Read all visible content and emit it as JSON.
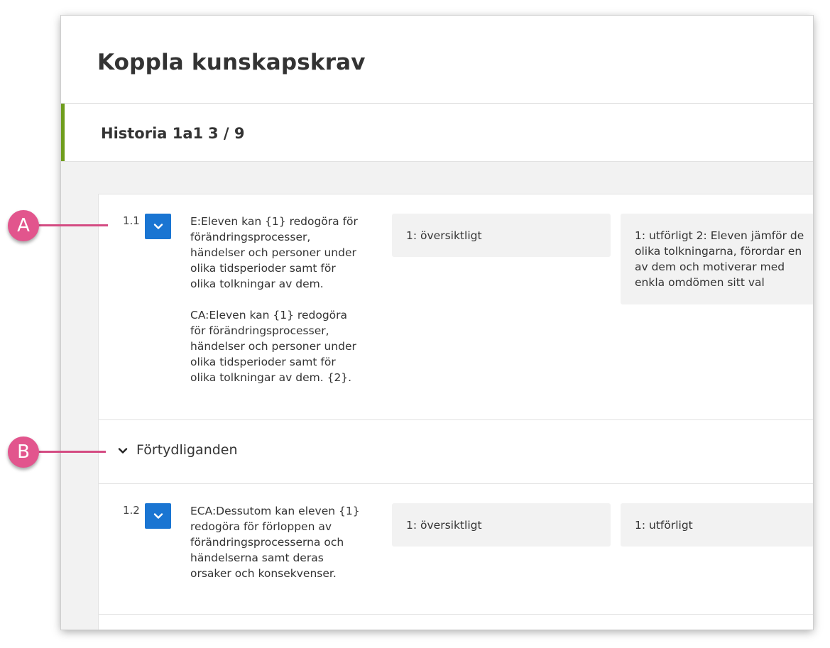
{
  "dialog": {
    "title": "Koppla kunskapskrav"
  },
  "subject": {
    "name": "Historia 1a1",
    "progress": "3 / 9",
    "accent_color": "#6f9d1c"
  },
  "criteria": [
    {
      "number": "1.1",
      "checked": true,
      "text_e": "E:Eleven kan {1} redogöra för förändringsprocesser, händelser och personer under olika tidsperioder samt för olika tolkningar av dem.",
      "text_ca": "CA:Eleven kan {1} redogöra för förändringsprocesser, händelser och personer under olika tidsperioder samt för olika tolkningar av dem. {2}.",
      "level_1": "1: översiktligt",
      "level_2": "1: utförligt 2: Eleven jämför de olika tolkningarna, förordar en av dem och motiverar med enkla omdömen sitt val"
    },
    {
      "number": "1.2",
      "checked": true,
      "text": "ECA:Dessutom kan eleven {1} redogöra för förloppen av förändringsprocesserna och händelserna samt deras orsaker och konsekvenser.",
      "level_1": "1: översiktligt",
      "level_2": "1: utförligt"
    }
  ],
  "clarifications": {
    "label": "Förtydliganden",
    "icon": "chevron-down-icon"
  },
  "callouts": {
    "a": "A",
    "b": "B",
    "color": "#e2558d"
  },
  "colors": {
    "checkbox": "#1a75d2",
    "background": "#f2f2f2"
  }
}
